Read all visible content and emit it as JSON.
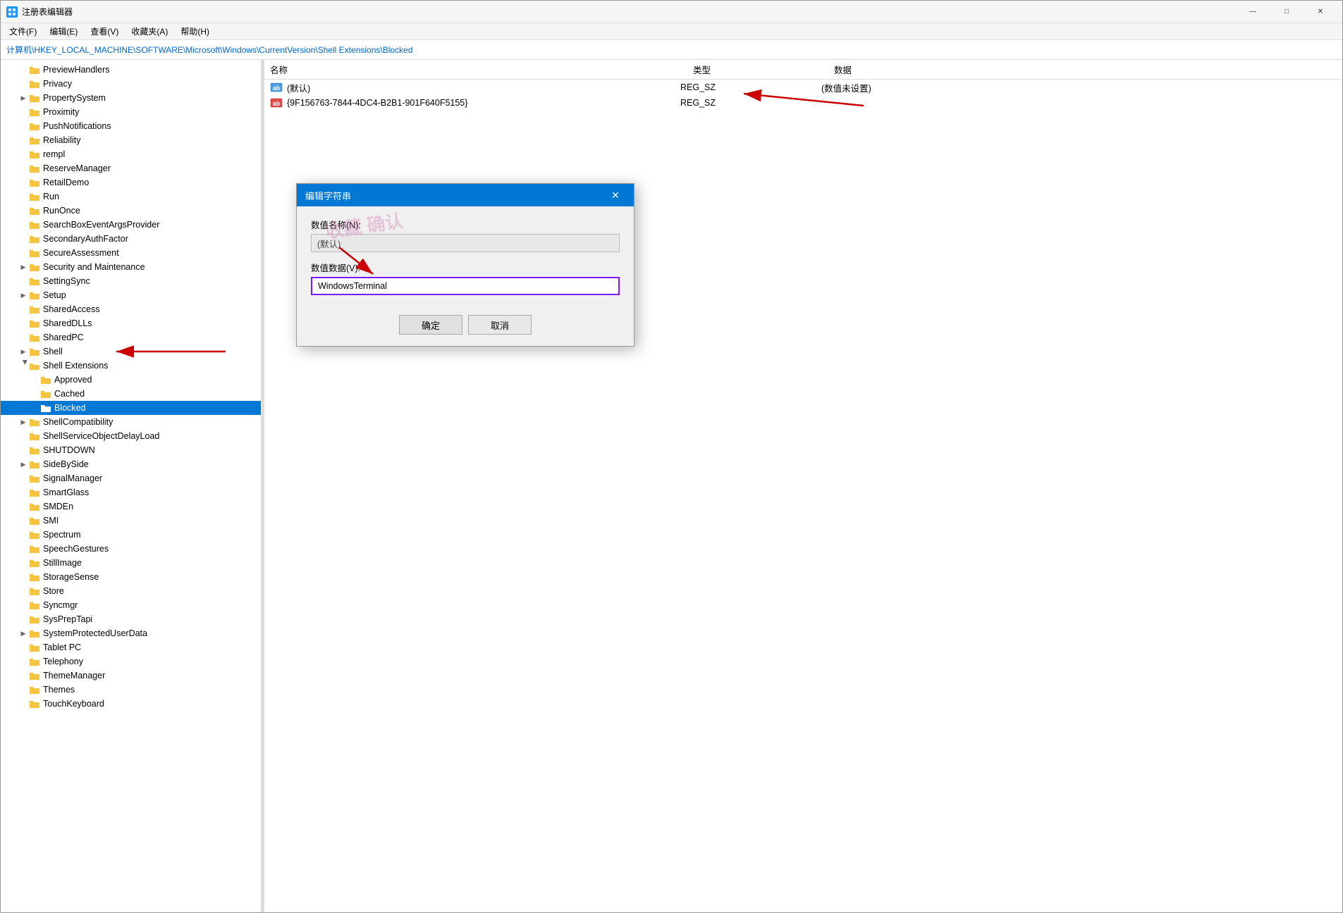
{
  "window": {
    "title": "注册表编辑器",
    "icon": "regedit-icon"
  },
  "titlebar": {
    "minimize_label": "—",
    "maximize_label": "□",
    "close_label": "✕"
  },
  "menubar": {
    "items": [
      {
        "label": "文件(F)"
      },
      {
        "label": "编辑(E)"
      },
      {
        "label": "查看(V)"
      },
      {
        "label": "收藏夹(A)"
      },
      {
        "label": "帮助(H)"
      }
    ]
  },
  "breadcrumb": {
    "path": "计算机\\HKEY_LOCAL_MACHINE\\SOFTWARE\\Microsoft\\Windows\\CurrentVersion\\Shell Extensions\\Blocked"
  },
  "table": {
    "headers": {
      "name": "名称",
      "type": "类型",
      "data": "数据"
    },
    "rows": [
      {
        "name": "(默认)",
        "type": "REG_SZ",
        "data": "(数值未设置)",
        "icon_type": "default"
      },
      {
        "name": "{9F156763-7844-4DC4-B2B1-901F640F5155}",
        "type": "REG_SZ",
        "data": "",
        "icon_type": "string"
      }
    ]
  },
  "tree": {
    "items": [
      {
        "label": "PreviewHandlers",
        "level": 2,
        "expanded": false,
        "has_children": false
      },
      {
        "label": "Privacy",
        "level": 2,
        "expanded": false,
        "has_children": false
      },
      {
        "label": "PropertySystem",
        "level": 2,
        "expanded": false,
        "has_children": true
      },
      {
        "label": "Proximity",
        "level": 2,
        "expanded": false,
        "has_children": false
      },
      {
        "label": "PushNotifications",
        "level": 2,
        "expanded": false,
        "has_children": false
      },
      {
        "label": "Reliability",
        "level": 2,
        "expanded": false,
        "has_children": false
      },
      {
        "label": "rempl",
        "level": 2,
        "expanded": false,
        "has_children": false
      },
      {
        "label": "ReserveManager",
        "level": 2,
        "expanded": false,
        "has_children": false
      },
      {
        "label": "RetailDemo",
        "level": 2,
        "expanded": false,
        "has_children": false
      },
      {
        "label": "Run",
        "level": 2,
        "expanded": false,
        "has_children": false
      },
      {
        "label": "RunOnce",
        "level": 2,
        "expanded": false,
        "has_children": false
      },
      {
        "label": "SearchBoxEventArgsProvider",
        "level": 2,
        "expanded": false,
        "has_children": false
      },
      {
        "label": "SecondaryAuthFactor",
        "level": 2,
        "expanded": false,
        "has_children": false
      },
      {
        "label": "SecureAssessment",
        "level": 2,
        "expanded": false,
        "has_children": false
      },
      {
        "label": "Security and Maintenance",
        "level": 2,
        "expanded": false,
        "has_children": true
      },
      {
        "label": "SettingSync",
        "level": 2,
        "expanded": false,
        "has_children": false
      },
      {
        "label": "Setup",
        "level": 2,
        "expanded": false,
        "has_children": true
      },
      {
        "label": "SharedAccess",
        "level": 2,
        "expanded": false,
        "has_children": false
      },
      {
        "label": "SharedDLLs",
        "level": 2,
        "expanded": false,
        "has_children": false
      },
      {
        "label": "SharedPC",
        "level": 2,
        "expanded": false,
        "has_children": false
      },
      {
        "label": "Shell",
        "level": 2,
        "expanded": false,
        "has_children": true
      },
      {
        "label": "Shell Extensions",
        "level": 2,
        "expanded": true,
        "has_children": true
      },
      {
        "label": "Approved",
        "level": 3,
        "expanded": false,
        "has_children": false
      },
      {
        "label": "Cached",
        "level": 3,
        "expanded": false,
        "has_children": false
      },
      {
        "label": "Blocked",
        "level": 3,
        "expanded": false,
        "has_children": false,
        "selected": true
      },
      {
        "label": "ShellCompatibility",
        "level": 2,
        "expanded": false,
        "has_children": true
      },
      {
        "label": "ShellServiceObjectDelayLoad",
        "level": 2,
        "expanded": false,
        "has_children": false
      },
      {
        "label": "SHUTDOWN",
        "level": 2,
        "expanded": false,
        "has_children": false
      },
      {
        "label": "SideBySide",
        "level": 2,
        "expanded": false,
        "has_children": true
      },
      {
        "label": "SignalManager",
        "level": 2,
        "expanded": false,
        "has_children": false
      },
      {
        "label": "SmartGlass",
        "level": 2,
        "expanded": false,
        "has_children": false
      },
      {
        "label": "SMDEn",
        "level": 2,
        "expanded": false,
        "has_children": false
      },
      {
        "label": "SMI",
        "level": 2,
        "expanded": false,
        "has_children": false
      },
      {
        "label": "Spectrum",
        "level": 2,
        "expanded": false,
        "has_children": false
      },
      {
        "label": "SpeechGestures",
        "level": 2,
        "expanded": false,
        "has_children": false
      },
      {
        "label": "StillImage",
        "level": 2,
        "expanded": false,
        "has_children": false
      },
      {
        "label": "StorageSense",
        "level": 2,
        "expanded": false,
        "has_children": false
      },
      {
        "label": "Store",
        "level": 2,
        "expanded": false,
        "has_children": false
      },
      {
        "label": "Syncmgr",
        "level": 2,
        "expanded": false,
        "has_children": false
      },
      {
        "label": "SysPrepTapi",
        "level": 2,
        "expanded": false,
        "has_children": false
      },
      {
        "label": "SystemProtectedUserData",
        "level": 2,
        "expanded": false,
        "has_children": true
      },
      {
        "label": "Tablet PC",
        "level": 2,
        "expanded": false,
        "has_children": false
      },
      {
        "label": "Telephony",
        "level": 2,
        "expanded": false,
        "has_children": false
      },
      {
        "label": "ThemeManager",
        "level": 2,
        "expanded": false,
        "has_children": false
      },
      {
        "label": "Themes",
        "level": 2,
        "expanded": false,
        "has_children": false
      },
      {
        "label": "TouchKeyboard",
        "level": 2,
        "expanded": false,
        "has_children": false
      }
    ]
  },
  "dialog": {
    "title": "编辑字符串",
    "close_label": "✕",
    "name_label": "数值名称(N):",
    "name_value": "(默认)",
    "data_label": "数值数据(V):",
    "data_value": "WindowsTerminal",
    "ok_label": "确定",
    "cancel_label": "取消"
  },
  "watermark": {
    "text": "收藏 确认"
  },
  "colors": {
    "accent": "#0078d4",
    "folder_yellow": "#f5c542",
    "selected_bg": "#0078d4",
    "arrow_red": "#cc0000"
  }
}
